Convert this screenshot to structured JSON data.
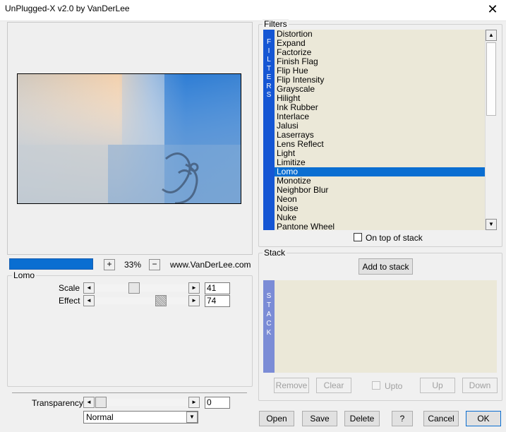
{
  "window": {
    "title": "UnPlugged-X v2.0 by VanDerLee",
    "close_glyph": "✕"
  },
  "preview": {
    "zoom": "33%",
    "plus": "+",
    "minus": "−",
    "website": "www.VanDerLee.com",
    "progress": 1.0
  },
  "params": {
    "group_label": "Lomo",
    "scale_label": "Scale",
    "scale_value": "41",
    "scale_pct": 41,
    "effect_label": "Effect",
    "effect_value": "74",
    "effect_pct": 74
  },
  "transparency": {
    "label": "Transparency",
    "value": "0",
    "blend_mode": "Normal"
  },
  "filters": {
    "group_label": "Filters",
    "vertical_label": [
      "F",
      "I",
      "L",
      "T",
      "E",
      "R",
      "S"
    ],
    "items": [
      "Distortion",
      "Expand",
      "Factorize",
      "Finish Flag",
      "Flip Hue",
      "Flip Intensity",
      "Grayscale",
      "Hilight",
      "Ink Rubber",
      "Interlace",
      "Jalusi",
      "Laserrays",
      "Lens Reflect",
      "Light",
      "Limitize",
      "Lomo",
      "Monotize",
      "Neighbor Blur",
      "Neon",
      "Noise",
      "Nuke",
      "Pantone Wheel"
    ],
    "selected": "Lomo",
    "on_top_label": "On top of stack"
  },
  "stack": {
    "group_label": "Stack",
    "vertical_label": [
      "S",
      "T",
      "A",
      "C",
      "K"
    ],
    "add_label": "Add to stack",
    "remove_label": "Remove",
    "clear_label": "Clear",
    "upto_label": "Upto",
    "up_label": "Up",
    "down_label": "Down"
  },
  "buttons": {
    "open": "Open",
    "save": "Save",
    "delete": "Delete",
    "help": "?",
    "cancel": "Cancel",
    "ok": "OK"
  },
  "icons": {
    "left_arrow": "◄",
    "right_arrow": "►",
    "up_arrow": "▲",
    "down_arrow": "▼",
    "dropdown_arrow": "▼"
  },
  "colors": {
    "accent": "#0a6ed1",
    "filters_bar": "#1556d4",
    "stack_bar": "#7b8cd6",
    "list_bg": "#ebe8d8"
  }
}
